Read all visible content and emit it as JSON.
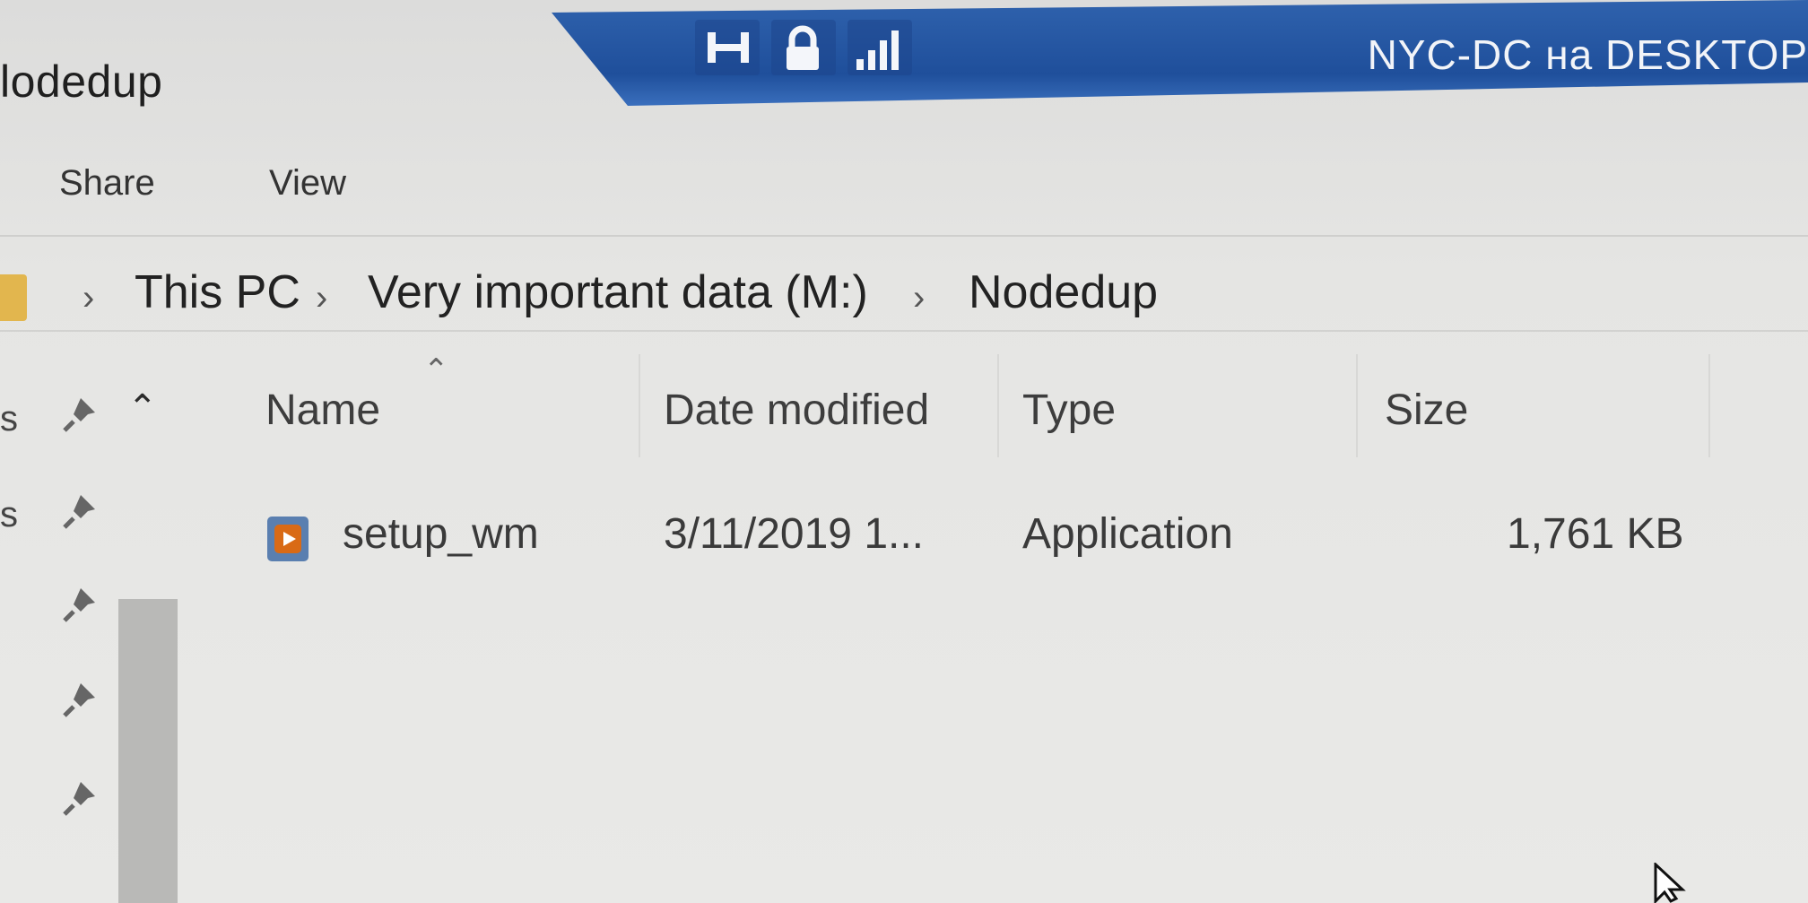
{
  "window": {
    "title": "lodedup"
  },
  "rdp": {
    "connection_title": "NYC-DC на DESKTOP",
    "icons": [
      "pin-icon",
      "lock-icon",
      "signal-icon"
    ]
  },
  "ribbon": {
    "tabs": [
      "Share",
      "View"
    ]
  },
  "address": {
    "crumbs": [
      "This PC",
      "Very important data (M:)",
      "Nodedup"
    ]
  },
  "nav": {
    "edge_labels": [
      "s",
      "s"
    ]
  },
  "columns": {
    "name": "Name",
    "date_modified": "Date modified",
    "type": "Type",
    "size": "Size"
  },
  "files": [
    {
      "name": "setup_wm",
      "date_modified": "3/11/2019 1...",
      "type": "Application",
      "size": "1,761 KB",
      "icon": "application-icon"
    }
  ],
  "colors": {
    "rdp_bar": "#2f62ad",
    "folder": "#e2b64e",
    "app_icon": "#d96a16"
  }
}
